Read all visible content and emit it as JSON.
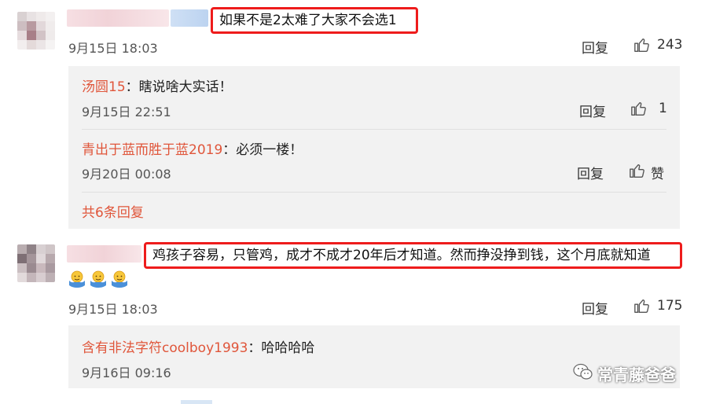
{
  "comments": [
    {
      "text": "如果不是2太难了大家不会选1",
      "date": "9月15日 18:03",
      "reply_label": "回复",
      "likes": "243",
      "replies": [
        {
          "user": "汤圆15",
          "text": "：瞎说啥大实话！",
          "date": "9月15日 22:51",
          "reply_label": "回复",
          "likes": "1"
        },
        {
          "user": "青出于蓝而胜于蓝2019",
          "text": "：必须一楼！",
          "date": "9月20日 00:08",
          "reply_label": "回复",
          "likes": "赞"
        }
      ],
      "more_replies": "共6条回复"
    },
    {
      "text": "鸡孩子容易，只管鸡，成才不成才20年后才知道。然而挣没挣到钱，这个月底就知道",
      "emoji_icon": "shrug-emoji",
      "date": "9月15日 18:03",
      "reply_label": "回复",
      "likes": "175",
      "replies": [
        {
          "user": "含有非法字符coolboy1993",
          "text": "：哈哈哈哈",
          "date": "9月16日 09:16"
        }
      ]
    }
  ],
  "watermark": {
    "text": "常青藤爸爸",
    "icon": "wechat-icon"
  },
  "colors": {
    "highlight_border": "#ee1c1c",
    "username": "#e0563b",
    "panel_bg": "#f2f2f2"
  }
}
